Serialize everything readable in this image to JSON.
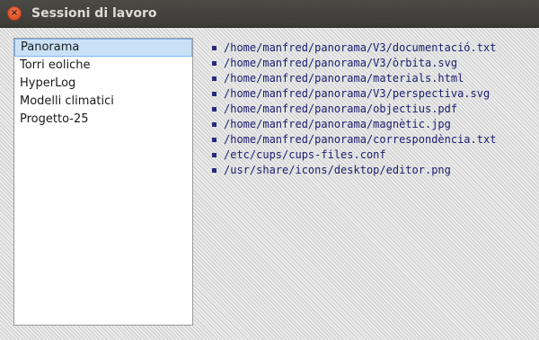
{
  "window": {
    "title": "Sessioni di lavoro",
    "close_icon": "×"
  },
  "sessions": [
    {
      "label": "Panorama",
      "selected": true
    },
    {
      "label": "Torri eoliche",
      "selected": false
    },
    {
      "label": "HyperLog",
      "selected": false
    },
    {
      "label": "Modelli climatici",
      "selected": false
    },
    {
      "label": "Progetto-25",
      "selected": false
    }
  ],
  "files": [
    "/home/manfred/panorama/V3/documentació.txt",
    "/home/manfred/panorama/V3/òrbita.svg",
    "/home/manfred/panorama/materials.html",
    "/home/manfred/panorama/V3/perspectiva.svg",
    "/home/manfred/panorama/objectius.pdf",
    "/home/manfred/panorama/magnètic.jpg",
    "/home/manfred/panorama/correspondència.txt",
    "/etc/cups/cups-files.conf",
    "/usr/share/icons/desktop/editor.png"
  ],
  "colors": {
    "selection_background": "#c9e1f7",
    "file_text": "#1c1c6e",
    "close_button": "#e2512a"
  }
}
